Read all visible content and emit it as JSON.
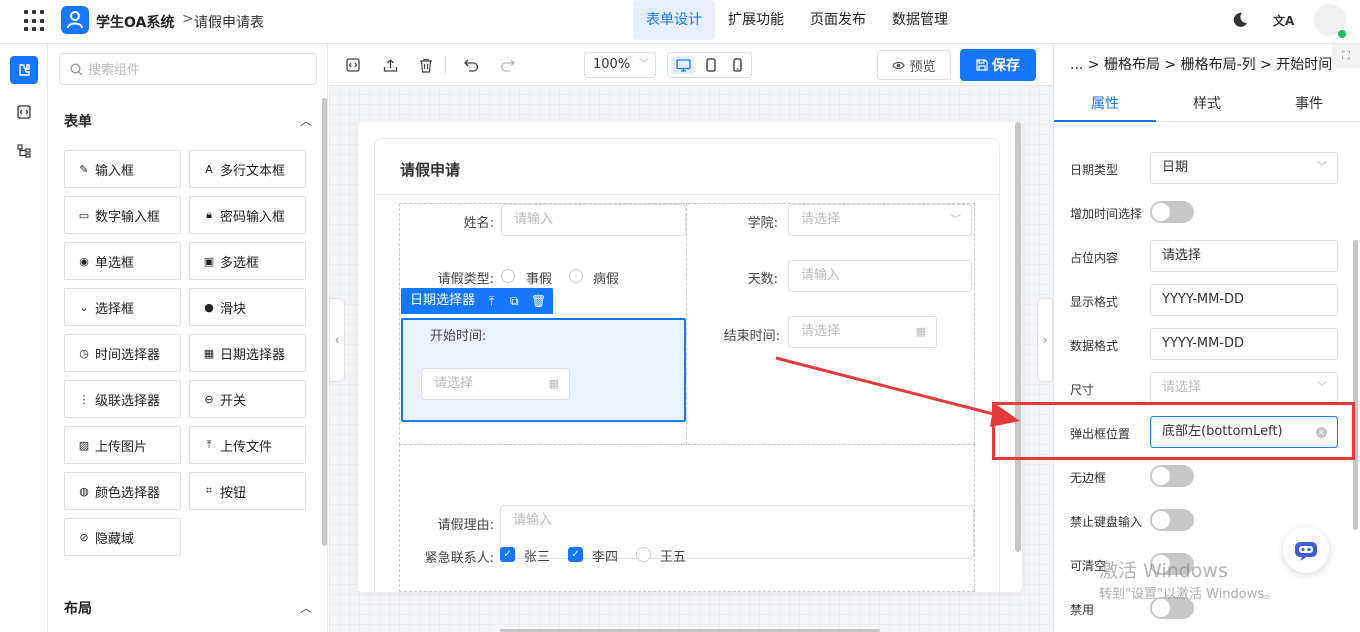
{
  "app": {
    "title": "学生OA系统",
    "crumb_sep": ">",
    "page": "请假申请表"
  },
  "topnav": [
    "表单设计",
    "扩展功能",
    "页面发布",
    "数据管理"
  ],
  "topright": {
    "translate": "文A"
  },
  "left_panel": {
    "search_placeholder": "搜索组件",
    "section_form": "表单",
    "section_layout": "布局",
    "components": [
      {
        "label": "输入框",
        "icon": "✎"
      },
      {
        "label": "多行文本框",
        "icon": "A"
      },
      {
        "label": "数字输入框",
        "icon": "▭"
      },
      {
        "label": "密码输入框",
        "icon": "🔒︎"
      },
      {
        "label": "单选框",
        "icon": "◉"
      },
      {
        "label": "多选框",
        "icon": "▣"
      },
      {
        "label": "选择框",
        "icon": "⌄"
      },
      {
        "label": "滑块",
        "icon": "●"
      },
      {
        "label": "时间选择器",
        "icon": "◷"
      },
      {
        "label": "日期选择器",
        "icon": "▦"
      },
      {
        "label": "级联选择器",
        "icon": "⋮"
      },
      {
        "label": "开关",
        "icon": "⊖"
      },
      {
        "label": "上传图片",
        "icon": "▨"
      },
      {
        "label": "上传文件",
        "icon": "⤒"
      },
      {
        "label": "颜色选择器",
        "icon": "◍"
      },
      {
        "label": "按钮",
        "icon": "⌗"
      },
      {
        "label": "隐藏域",
        "icon": "⊘"
      }
    ]
  },
  "toolbar": {
    "zoom": "100%",
    "preview": "预览",
    "save": "保存"
  },
  "form": {
    "title": "请假申请",
    "name_label": "姓名:",
    "name_placeholder": "请输入",
    "college_label": "学院:",
    "college_placeholder": "请选择",
    "leave_type_label": "请假类型:",
    "leave_options": [
      "事假",
      "病假"
    ],
    "days_label": "天数:",
    "days_placeholder": "请输入",
    "selected_tag": "日期选择器",
    "start_label": "开始时间:",
    "start_placeholder": "请选择",
    "end_label": "结束时间:",
    "end_placeholder": "请选择",
    "reason_label": "请假理由:",
    "reason_placeholder": "请输入",
    "contact_label": "紧急联系人:",
    "contacts": [
      {
        "name": "张三",
        "checked": true
      },
      {
        "name": "李四",
        "checked": true
      },
      {
        "name": "王五",
        "checked": false
      }
    ]
  },
  "right_panel": {
    "breadcrumb": "... > 栅格布局 > 栅格布局-列 > 开始时间",
    "tabs": [
      "属性",
      "样式",
      "事件"
    ],
    "rows": [
      {
        "label": "日期类型",
        "value": "日期"
      },
      {
        "label": "增加时间选择"
      },
      {
        "label": "占位内容",
        "value": "请选择"
      },
      {
        "label": "显示格式",
        "value": "YYYY-MM-DD"
      },
      {
        "label": "数据格式",
        "value": "YYYY-MM-DD"
      },
      {
        "label": "尺寸",
        "placeholder": "请选择"
      },
      {
        "label": "弹出框位置",
        "value": "底部左(bottomLeft)"
      },
      {
        "label": "无边框"
      },
      {
        "label": "禁止键盘输入"
      },
      {
        "label": "可清空"
      },
      {
        "label": "禁用"
      }
    ]
  },
  "watermark": {
    "line1": "激活 Windows",
    "line2": "转到\"设置\"以激活 Windows。"
  },
  "colors": {
    "accent": "#1677ff",
    "highlight": "#e33b3b"
  }
}
